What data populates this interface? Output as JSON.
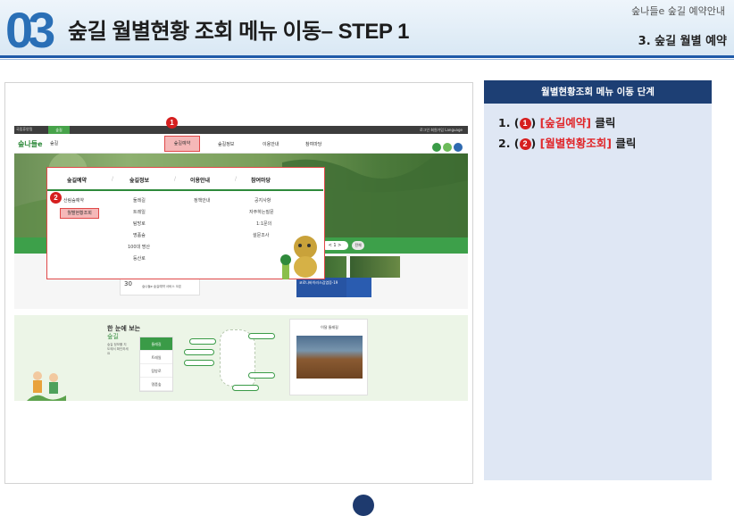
{
  "header": {
    "number": "03",
    "title": "숲길 월별현황 조회 메뉴 이동– STEP 1",
    "top_right": "숲나들e 숲길 예약안내",
    "subtitle": "3. 숲길 월별 예약"
  },
  "site": {
    "topbar_left": "국립휴양림",
    "topbar_tab": "숲길",
    "topbar_right": "로그인  회원가입  Language",
    "logo": "숲나들e",
    "logo_sub": "숲길",
    "nav": [
      "숲길예약",
      "숲길정보",
      "이용안내",
      "참여마당"
    ],
    "pager": "< 1 >",
    "pager_btn": "전체",
    "card_number": "30",
    "card_text": "숲나들e 숲길예약 서비스 오픈",
    "covid_text": "코로나바이러스감염증-19",
    "lower": {
      "title": "한 눈에 보는",
      "title2": "숲길",
      "small": "숲길 정보를 지도에서 확인하세요",
      "menu": [
        "둘레길",
        "트레일",
        "탐방로",
        "명품숲"
      ],
      "card_title": "이달 둘레길"
    },
    "dropdown": {
      "headers": [
        "숲길예약",
        "숲길정보",
        "이용안내",
        "참여마당"
      ],
      "col1": [
        "산림숲예약",
        "월별현황조회"
      ],
      "col2": [
        "둘레길",
        "트레일",
        "탐방로",
        "명품숲",
        "100대 명산",
        "등산로"
      ],
      "col3": [
        "정책안내"
      ],
      "col4": [
        "공지사항",
        "자주하는질문",
        "1:1문의",
        "설문조사"
      ]
    },
    "badges": [
      "1",
      "2"
    ]
  },
  "panel": {
    "title": "월별현황조회 메뉴 이동 단계",
    "steps": [
      {
        "prefix": "1. (",
        "num": "1",
        "mid": ")",
        "label": "[숲길예약]",
        "suffix": " 클릭"
      },
      {
        "prefix": "2. (",
        "num": "2",
        "mid": ")",
        "label": "[월별현황조회]",
        "suffix": " 클릭"
      }
    ]
  }
}
